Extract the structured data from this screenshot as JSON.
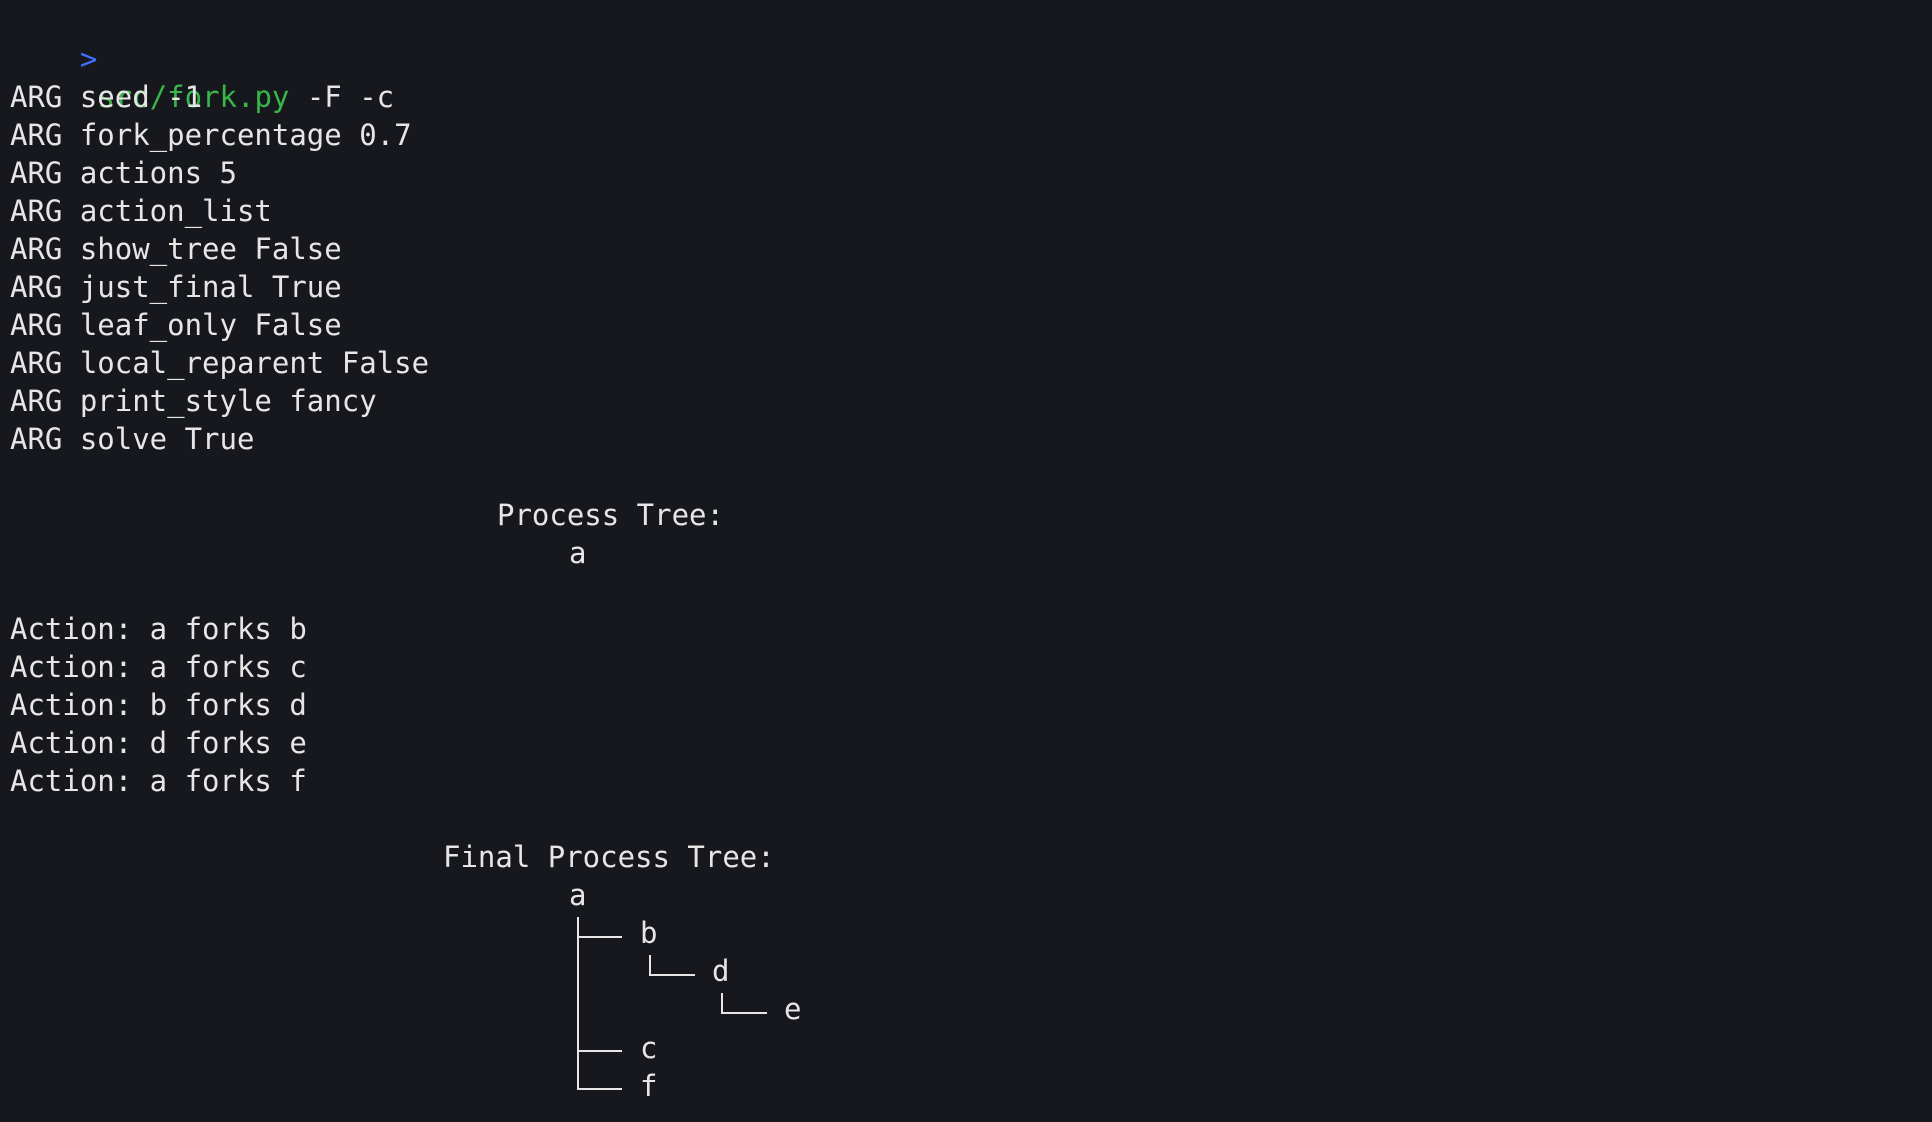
{
  "prompt": {
    "symbol": ">",
    "command": "src/fork.py",
    "args": " -F -c"
  },
  "arg_lines": [
    "ARG seed -1",
    "ARG fork_percentage 0.7",
    "ARG actions 5",
    "ARG action_list",
    "ARG show_tree False",
    "ARG just_final True",
    "ARG leaf_only False",
    "ARG local_reparent False",
    "ARG print_style fancy",
    "ARG solve True"
  ],
  "initial_tree": {
    "title": "Process Tree:",
    "root": "a"
  },
  "actions": [
    "Action: a forks b",
    "Action: a forks c",
    "Action: b forks d",
    "Action: d forks e",
    "Action: a forks f"
  ],
  "final_tree": {
    "title": "Final Process Tree:",
    "root": "a",
    "nodes": [
      "b",
      "d",
      "e",
      "c",
      "f"
    ]
  },
  "colors": {
    "background": "#16181d",
    "text": "#e6e6e6",
    "prompt": "#3f6fff",
    "command": "#39b54a"
  }
}
